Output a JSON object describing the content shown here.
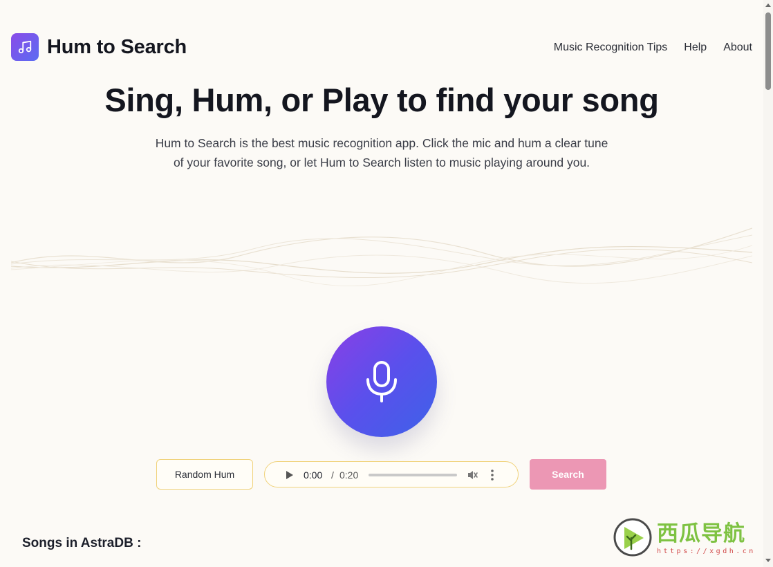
{
  "header": {
    "brand": "Hum to Search",
    "nav": [
      "Music Recognition Tips",
      "Help",
      "About"
    ]
  },
  "hero": {
    "title": "Sing, Hum, or Play to find your song",
    "subtitle_line1": "Hum to Search is the best music recognition app. Click the mic and hum a clear tune",
    "subtitle_line2": "of your favorite song, or let Hum to Search listen to music playing around you."
  },
  "controls": {
    "random_label": "Random Hum",
    "audio": {
      "current_time": "0:00",
      "separator": "/",
      "duration": "0:20",
      "progress": 0
    },
    "search_label": "Search"
  },
  "songs": {
    "heading": "Songs in AstraDB :"
  },
  "watermark": {
    "text": "西瓜导航",
    "url": "https://xgdh.cn"
  },
  "icons": {
    "logo": "music-note-icon",
    "mic": "microphone-icon",
    "play": "play-icon",
    "volume": "volume-muted-icon",
    "more": "more-vertical-icon"
  },
  "colors": {
    "background": "#fcfaf6",
    "accent_gradient_start": "#8a3fe6",
    "accent_gradient_end": "#3d62e8",
    "search_button": "#ec97b4",
    "control_border": "#f0d27a",
    "watermark_green": "#7ec242"
  }
}
